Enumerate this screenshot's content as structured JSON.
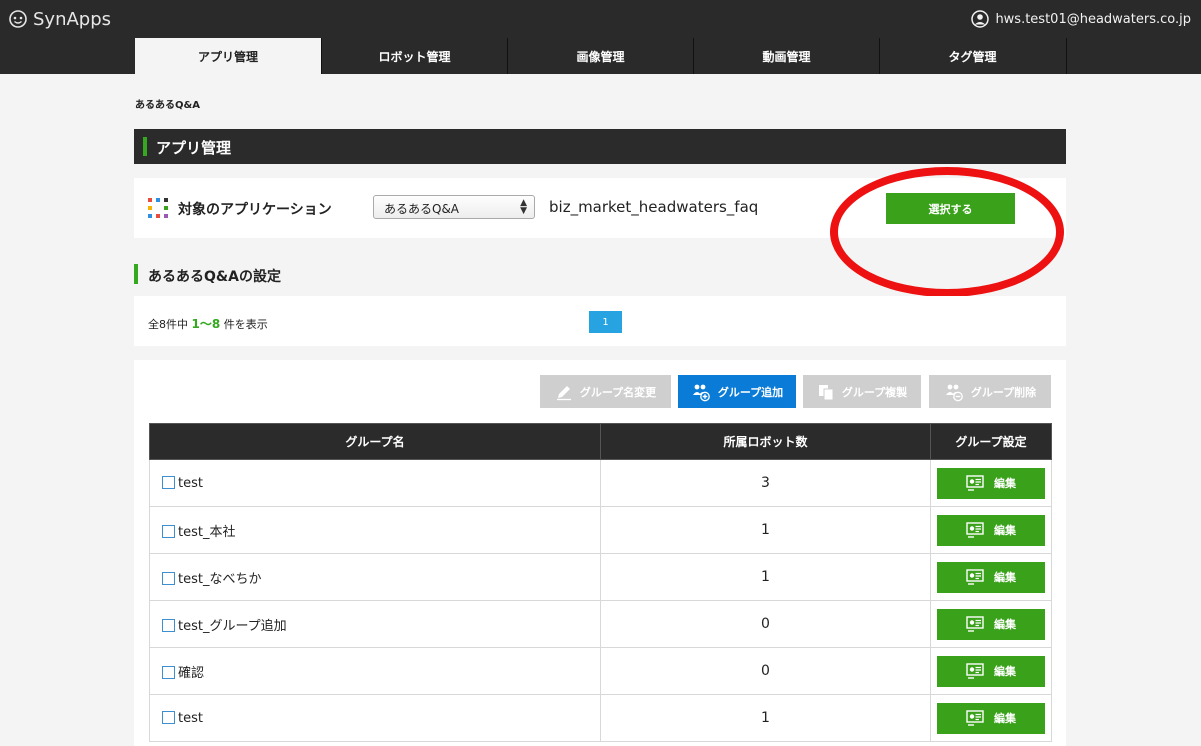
{
  "header": {
    "brand": "SynApps",
    "user_email": "hws.test01@headwaters.co.jp"
  },
  "nav": {
    "tabs": [
      {
        "label": "アプリ管理",
        "active": true
      },
      {
        "label": "ロボット管理",
        "active": false
      },
      {
        "label": "画像管理",
        "active": false
      },
      {
        "label": "動画管理",
        "active": false
      },
      {
        "label": "タグ管理",
        "active": false
      }
    ]
  },
  "breadcrumb": "あるあるQ&A",
  "section_title": "アプリ管理",
  "app_selector": {
    "label": "対象のアプリケーション",
    "selected": "あるあるQ&A",
    "app_id": "biz_market_headwaters_faq",
    "select_button": "選択する"
  },
  "settings_title": "あるあるQ&Aの設定",
  "pagination": {
    "prefix": "全8件中",
    "range": "1〜8",
    "suffix": "件を表示",
    "current_page": "1"
  },
  "toolbar": {
    "rename": "グループ名変更",
    "add": "グループ追加",
    "copy": "グループ複製",
    "delete": "グループ削除"
  },
  "table": {
    "headers": [
      "グループ名",
      "所属ロボット数",
      "グループ設定"
    ],
    "edit_label": "編集",
    "rows": [
      {
        "name": "test",
        "count": "3"
      },
      {
        "name": "test_本社",
        "count": "1"
      },
      {
        "name": "test_なべちか",
        "count": "1"
      },
      {
        "name": "test_グループ追加",
        "count": "0"
      },
      {
        "name": "確認",
        "count": "0"
      },
      {
        "name": "test",
        "count": "1"
      }
    ]
  },
  "colors": {
    "header_bg": "#2a2a2a",
    "accent_green": "#3aa11b",
    "accent_blue": "#0a7bd6",
    "page_blue": "#26a3e0",
    "highlight_red": "#ee1111"
  }
}
